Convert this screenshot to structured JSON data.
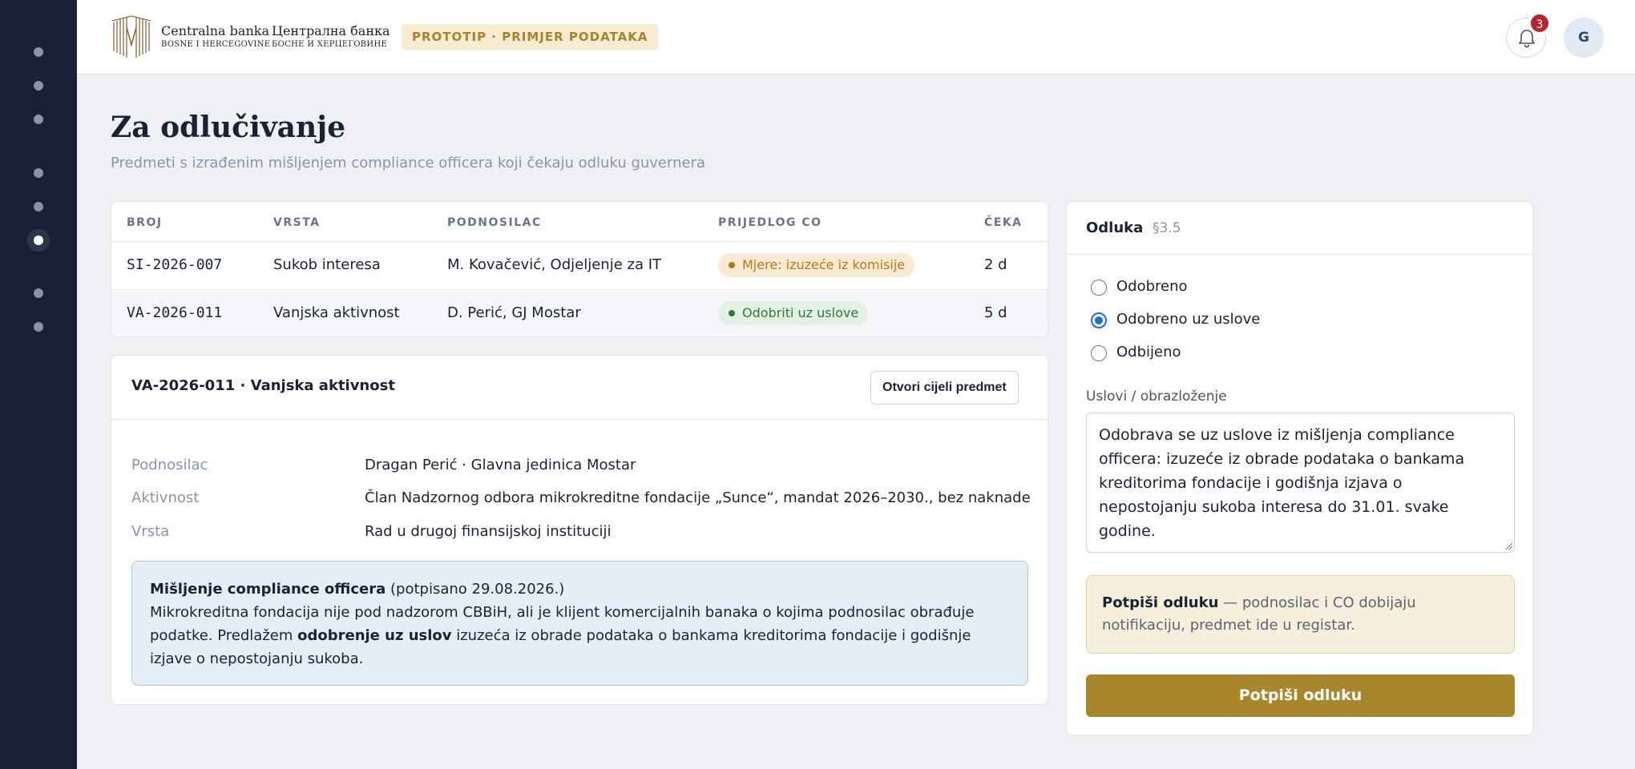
{
  "header": {
    "brand_latin_line1": "Centralna banka",
    "brand_latin_line2": "BOSNE I HERCEGOVINE",
    "brand_cyrillic_line1": "Централна банка",
    "brand_cyrillic_line2": "БОСНЕ И ХЕРЦЕГОВИНЕ",
    "prototype_badge": "PROTOTIP · PRIMJER PODATAKA",
    "notification_count": "3",
    "avatar_initial": "G"
  },
  "sidebar": {
    "items": [
      {
        "name": "nav-1",
        "active": false
      },
      {
        "name": "nav-2",
        "active": false
      },
      {
        "name": "nav-3",
        "active": false
      },
      {
        "name": "nav-4",
        "active": false
      },
      {
        "name": "nav-5",
        "active": false
      },
      {
        "name": "nav-6",
        "active": true
      },
      {
        "name": "nav-7",
        "active": false
      },
      {
        "name": "nav-8",
        "active": false
      }
    ]
  },
  "page": {
    "title": "Za odlučivanje",
    "subtitle": "Predmeti s izrađenim mišljenjem compliance officera koji čekaju odluku guvernera"
  },
  "table": {
    "columns": [
      "BROJ",
      "VRSTA",
      "PODNOSILAC",
      "PRIJEDLOG CO",
      "ČEKA"
    ],
    "rows": [
      {
        "broj": "SI-2026-007",
        "vrsta": "Sukob interesa",
        "podnosilac": "M. Kovačević, Odjeljenje za IT",
        "prijedlog": "Mjere: izuzeće iz komisije",
        "prijedlog_status": "warning",
        "ceka": "2  d",
        "selected": false
      },
      {
        "broj": "VA-2026-011",
        "vrsta": "Vanjska aktivnost",
        "podnosilac": "D. Perić, GJ Mostar",
        "prijedlog": "Odobriti uz uslove",
        "prijedlog_status": "success",
        "ceka": "5  d",
        "selected": true
      }
    ]
  },
  "detail": {
    "title": "VA-2026-011 · Vanjska aktivnost",
    "open_button": "Otvori cijeli predmet",
    "fields": [
      {
        "label": "Podnosilac",
        "value": "Dragan Perić · Glavna jedinica Mostar"
      },
      {
        "label": "Aktivnost",
        "value": "Član Nadzornog odbora mikrokreditne fondacije „Sunce“, mandat 2026–2030., bez naknade"
      },
      {
        "label": "Vrsta",
        "value": "Rad u drugoj finansijskoj instituciji"
      }
    ],
    "opinion": {
      "heading": "Mišljenje compliance officera",
      "signed": "(potpisano 29.08.2026.)",
      "text_before": "Mikrokreditna fondacija nije pod nadzorom CBBiH, ali je klijent komercijalnih banaka o kojima podnosilac obrađuje podatke. Predlažem ",
      "text_bold": "odobrenje uz uslov",
      "text_after": " izuzeća iz obrade podataka o bankama kreditorima fondacije i godišnje izjave o nepostojanju sukoba."
    }
  },
  "decision": {
    "title": "Odluka",
    "section": "§3.5",
    "options": [
      {
        "label": "Odobreno",
        "selected": false
      },
      {
        "label": "Odobreno uz uslove",
        "selected": true
      },
      {
        "label": "Odbijeno",
        "selected": false
      }
    ],
    "conditions_label": "Uslovi / obrazloženje",
    "conditions_value": "Odobrava se uz uslove iz mišljenja compliance officera: izuzeće iz obrade podataka o bankama kreditorima fondacije i godišnja izjava o nepostojanju sukoba interesa do 31.01. svake godine.",
    "note_bold": "Potpiši odluku",
    "note_text": " — podnosilac i CO dobijaju notifikaciju, predmet ide u registar.",
    "sign_button": "Potpiši odluku"
  },
  "colors": {
    "sidebar_bg": "#172036",
    "accent_gold": "#a8862a",
    "warning_pill_bg": "#fbead3",
    "success_pill_bg": "#e3f1e5",
    "opinion_bg": "#e6edf6",
    "badge_red": "#b3262e"
  },
  "icons": {
    "bell": "bell-icon",
    "logo": "cbbh-logo-mark"
  }
}
